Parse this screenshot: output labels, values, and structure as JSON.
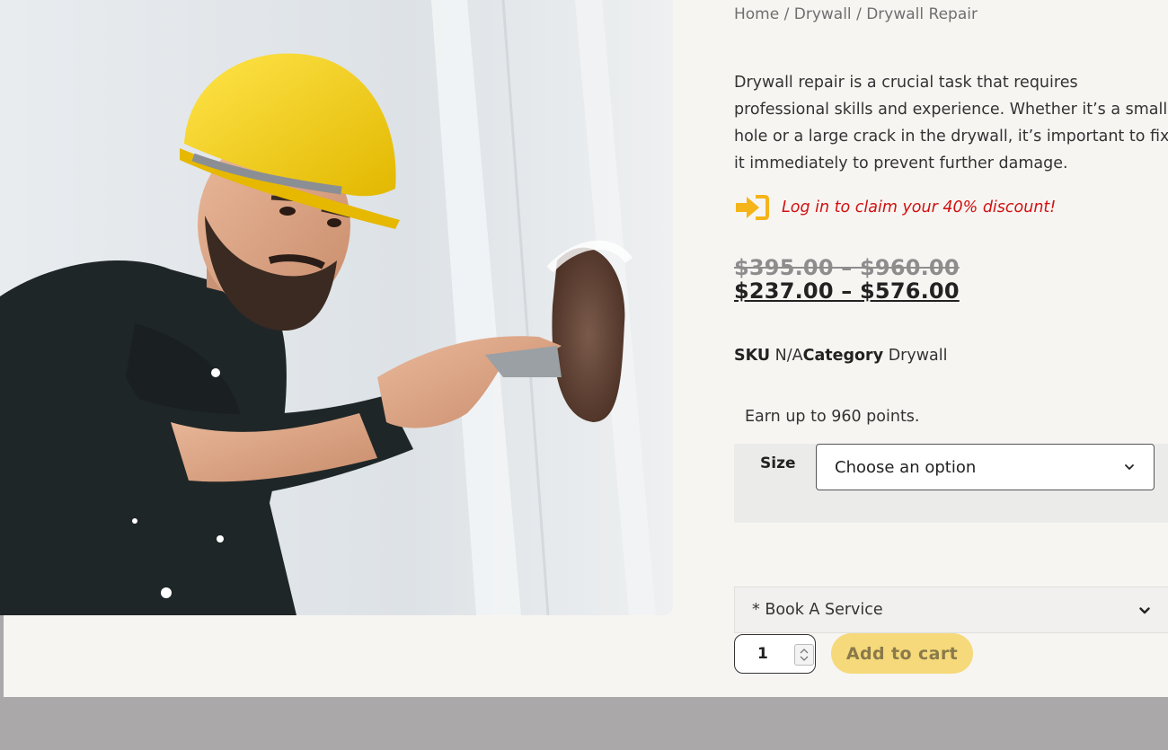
{
  "breadcrumb": {
    "home": "Home",
    "sep1": " / ",
    "category": "Drywall",
    "sep2": " / ",
    "current": "Drywall Repair"
  },
  "product": {
    "description": "Drywall repair is a crucial task that requires professional skills and experience. Whether it’s a small hole or a large crack in the drywall, it’s important to fix it immediately to prevent further damage.",
    "promo_text": "Log in to claim your 40% discount!",
    "promo_icon": "sign-in-arrow-icon",
    "price_original": "$395.00 – $960.00",
    "price_sale": "$237.00 – $576.00",
    "sku_label": "SKU",
    "sku_value": "N/A",
    "category_label": "Category",
    "category_value": "Drywall",
    "points_text": "Earn up to 960 points."
  },
  "variation": {
    "size_label": "Size",
    "size_selected": "Choose an option"
  },
  "booking": {
    "label": "* Book A Service"
  },
  "cart": {
    "quantity": "1",
    "add_to_cart_label": "Add to cart"
  },
  "colors": {
    "promo_red": "#d11111",
    "promo_icon_yellow": "#f4b41a",
    "add_to_cart_bg": "#f5d97a",
    "page_bg": "#f7f5f2",
    "footer_gray": "#aaa8a8"
  }
}
